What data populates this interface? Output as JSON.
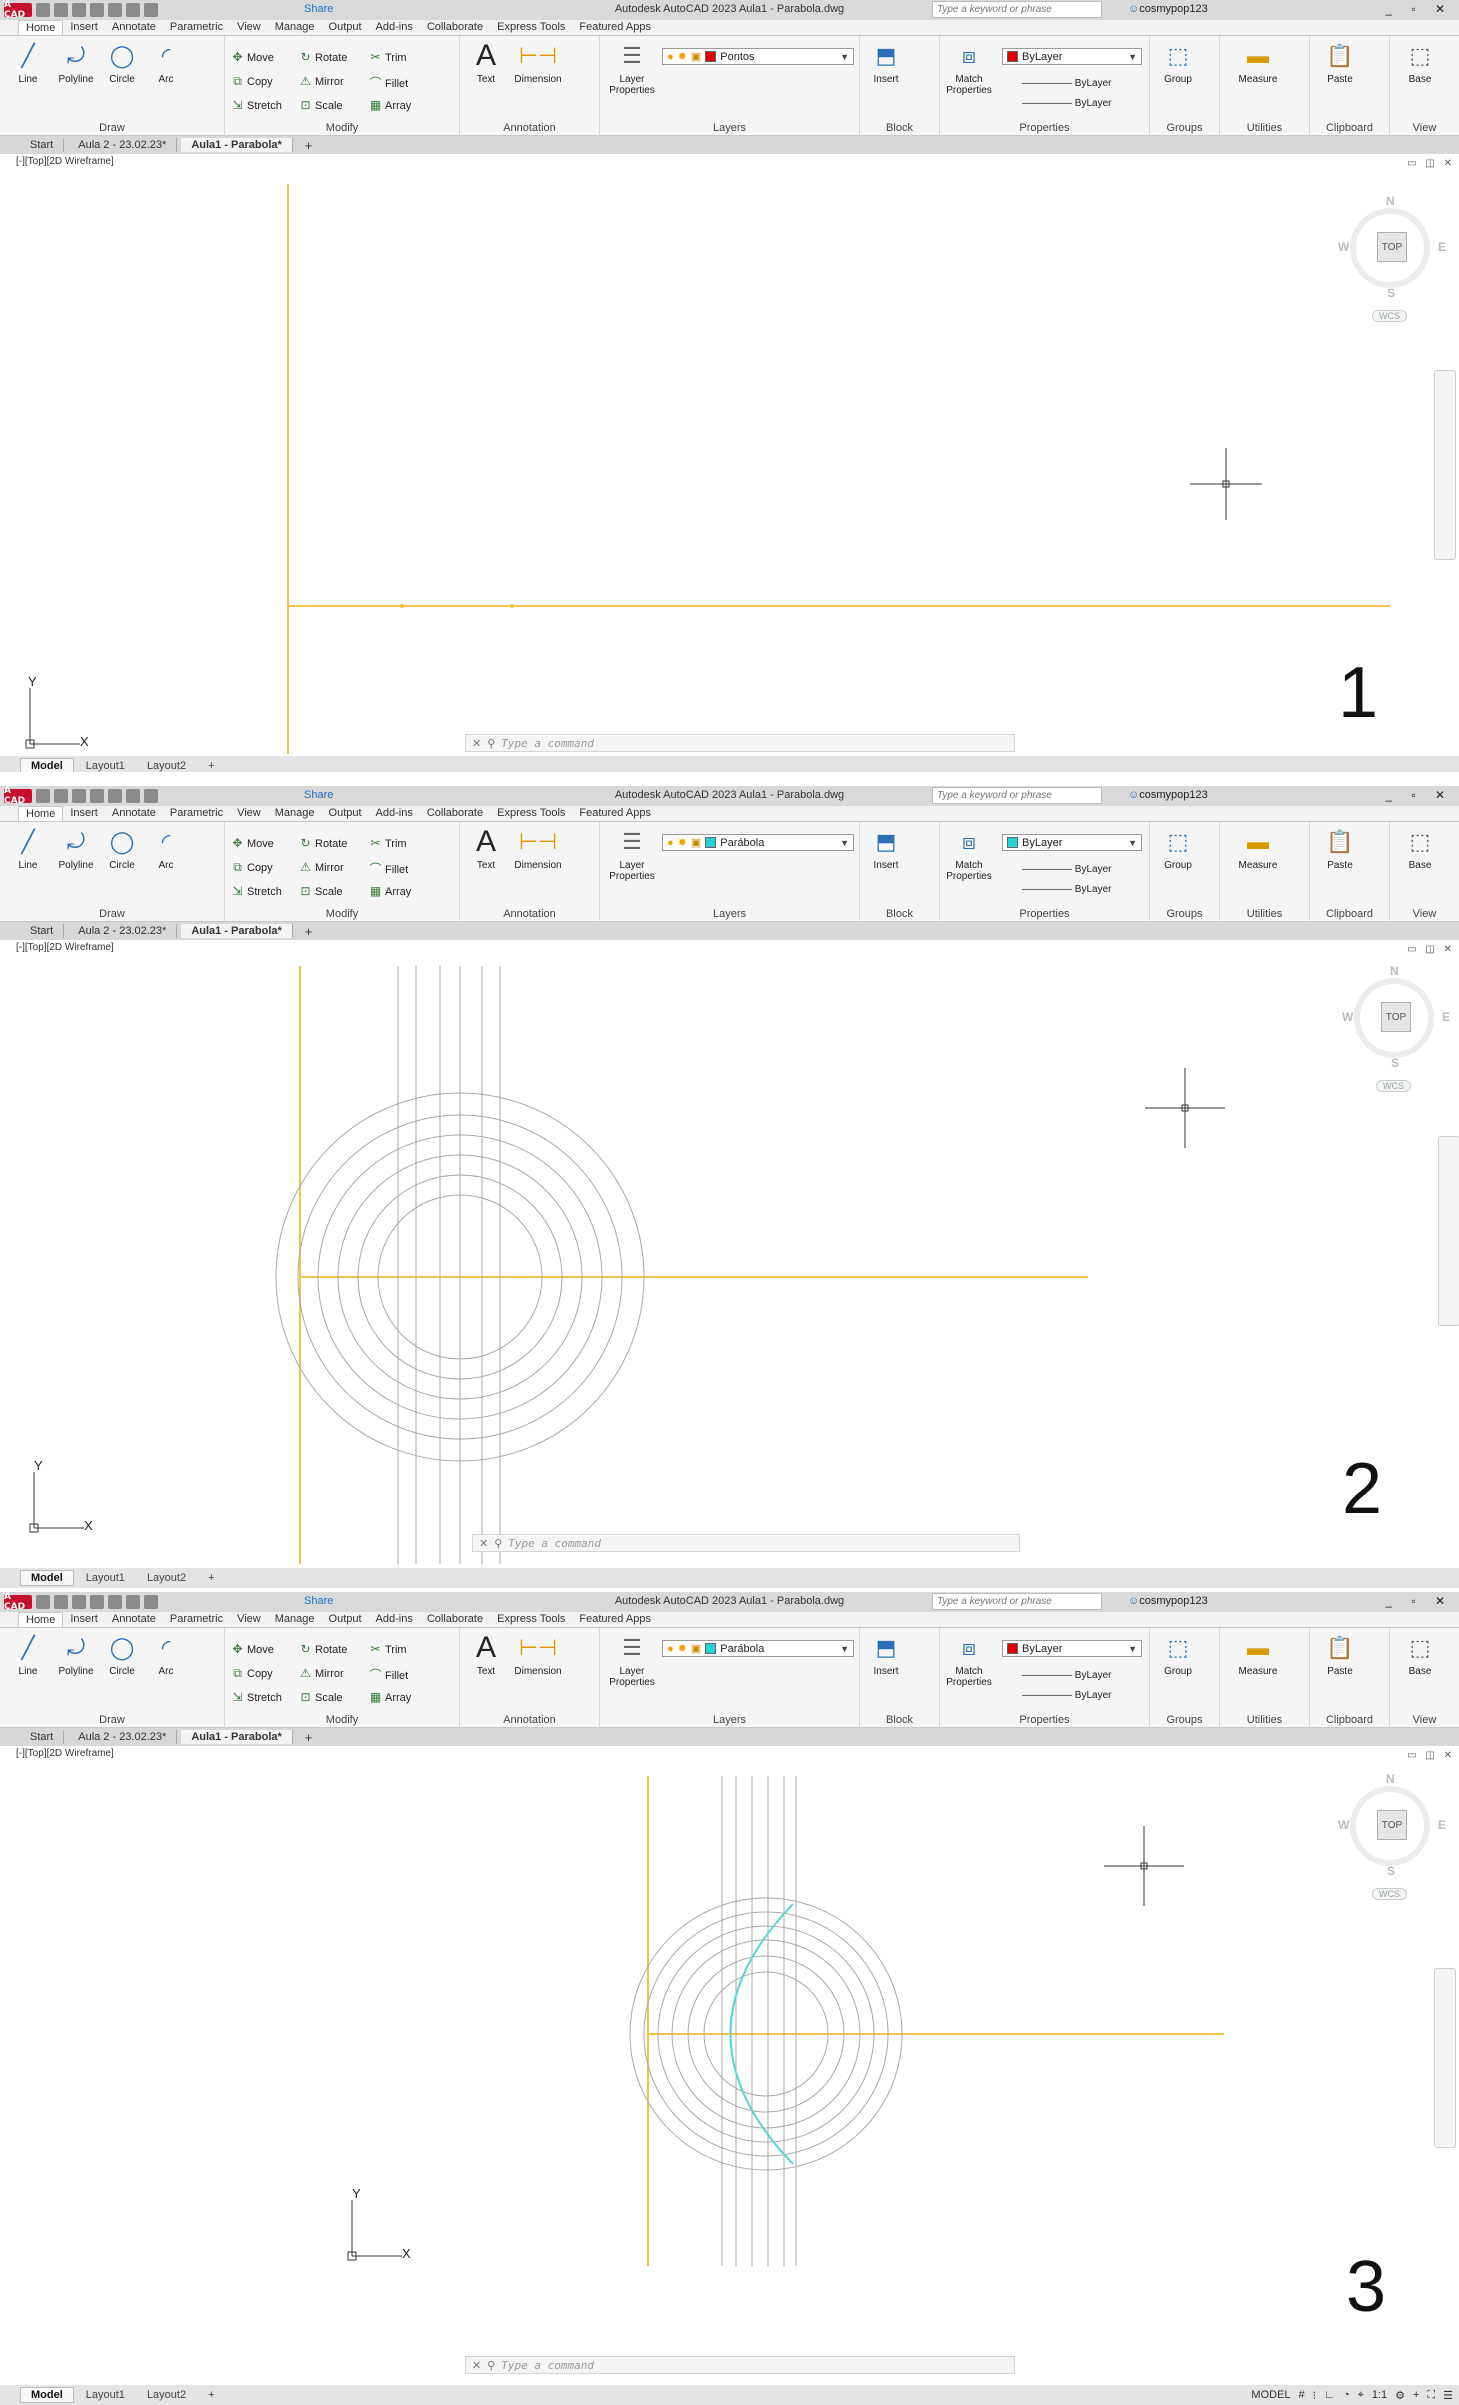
{
  "window": {
    "title": "Autodesk AutoCAD 2023   Aula1 - Parabola.dwg",
    "share": "Share",
    "search_placeholder": "Type a keyword or phrase",
    "user": "cosmypop123",
    "logo": "A CAD"
  },
  "ribbon": {
    "tabs": [
      "Home",
      "Insert",
      "Annotate",
      "Parametric",
      "View",
      "Manage",
      "Output",
      "Add-ins",
      "Collaborate",
      "Express Tools",
      "Featured Apps"
    ],
    "draw": {
      "line": "Line",
      "polyline": "Polyline",
      "circle": "Circle",
      "arc": "Arc",
      "title": "Draw"
    },
    "modify": {
      "move": "Move",
      "rotate": "Rotate",
      "trim": "Trim",
      "copy": "Copy",
      "mirror": "Mirror",
      "fillet": "Fillet",
      "stretch": "Stretch",
      "scale": "Scale",
      "array": "Array",
      "title": "Modify"
    },
    "annotation": {
      "text": "Text",
      "dimension": "Dimension",
      "title": "Annotation"
    },
    "layers": {
      "layer_properties": "Layer\nProperties",
      "title": "Layers"
    },
    "block": {
      "insert": "Insert",
      "title": "Block"
    },
    "properties": {
      "match": "Match\nProperties",
      "bylayer": "ByLayer",
      "title": "Properties"
    },
    "groups": {
      "group": "Group",
      "title": "Groups"
    },
    "utilities": {
      "measure": "Measure",
      "title": "Utilities"
    },
    "clipboard": {
      "paste": "Paste",
      "title": "Clipboard"
    },
    "view": {
      "base": "Base",
      "title": "View"
    }
  },
  "doc_tabs": [
    "Start",
    "Aula 2 - 23.02.23*",
    "Aula1 - Parabola*"
  ],
  "viewport_label": "[-][Top][2D Wireframe]",
  "viewcube": {
    "top": "TOP",
    "n": "N",
    "s": "S",
    "e": "E",
    "w": "W",
    "wcs": "WCS"
  },
  "ucs": {
    "x": "X",
    "y": "Y"
  },
  "command_placeholder": "Type a command",
  "layout_tabs": [
    "Model",
    "Layout1",
    "Layout2"
  ],
  "status": {
    "model": "MODEL",
    "scale": "1:1"
  },
  "steps": [
    {
      "number": "1",
      "layer": "Pontos",
      "layer_color": "#e00000",
      "prop_color": "ByLayer",
      "prop_swatch": "#e00000"
    },
    {
      "number": "2",
      "layer": "Parábola",
      "layer_color": "#22d3d3",
      "prop_color": "ByLayer",
      "prop_swatch": "#22d3d3"
    },
    {
      "number": "3",
      "layer": "Parábola",
      "layer_color": "#22d3d3",
      "prop_color": "ByLayer",
      "prop_swatch": "#e00000"
    }
  ],
  "colors": {
    "axis": "#f2c24a",
    "construction": "#a9a9a9",
    "parabola": "#5ad6d6",
    "cursor": "#333333"
  },
  "icons": [
    "search-icon",
    "user-icon",
    "cart-icon",
    "help-icon",
    "minimize-icon",
    "restore-icon",
    "close-icon",
    "line-icon",
    "polyline-icon",
    "circle-icon",
    "arc-icon",
    "move-icon",
    "rotate-icon",
    "trim-icon",
    "copy-icon",
    "mirror-icon",
    "fillet-icon",
    "stretch-icon",
    "scale-icon",
    "array-icon",
    "text-icon",
    "dimension-icon",
    "layer-icon",
    "insert-icon",
    "match-icon",
    "group-icon",
    "measure-icon",
    "paste-icon",
    "base-icon",
    "lightbulb-icon",
    "sun-icon",
    "lock-icon"
  ]
}
